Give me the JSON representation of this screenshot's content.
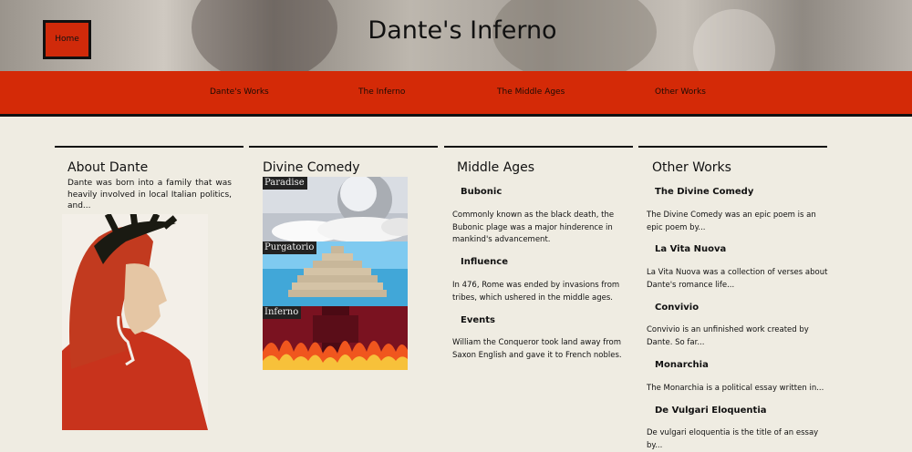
{
  "header": {
    "home_label": "Home",
    "site_title": "Dante's Inferno"
  },
  "nav": {
    "items": [
      {
        "label": "Dante's Works"
      },
      {
        "label": "The Inferno"
      },
      {
        "label": "The Middle Ages"
      },
      {
        "label": "Other Works"
      }
    ]
  },
  "about": {
    "heading": "About Dante",
    "text": "Dante was born into a family that was heavily involved in local Italian politics, and..."
  },
  "comedy": {
    "heading": "Divine Comedy",
    "panels": [
      "Paradise",
      "Purgatorio",
      "Inferno"
    ]
  },
  "middle_ages": {
    "heading": "Middle Ages",
    "sections": [
      {
        "title": "Bubonic",
        "text": "Commonly known as the black death, the Bubonic plage was a major hinderence in mankind's advancement."
      },
      {
        "title": "Influence",
        "text": "In 476, Rome was ended by invasions from tribes, which ushered in the middle ages."
      },
      {
        "title": "Events",
        "text": "William the Conqueror took land away from Saxon English and gave it to French nobles."
      }
    ]
  },
  "other_works": {
    "heading": "Other Works",
    "sections": [
      {
        "title": "The Divine Comedy",
        "text": "The Divine Comedy was an epic poem is an epic poem by..."
      },
      {
        "title": "La Vita Nuova",
        "text": "La Vita Nuova was a collection of verses about Dante's romance life..."
      },
      {
        "title": "Convivio",
        "text": "Convivio is an unfinished work created by Dante. So far..."
      },
      {
        "title": "Monarchia",
        "text": "The Monarchia is a political essay written in..."
      },
      {
        "title": "De Vulgari Eloquentia",
        "text": "De vulgari eloquentia is the title of an essay by..."
      }
    ]
  },
  "colors": {
    "accent_red": "#d42a07",
    "background": "#efece2"
  }
}
